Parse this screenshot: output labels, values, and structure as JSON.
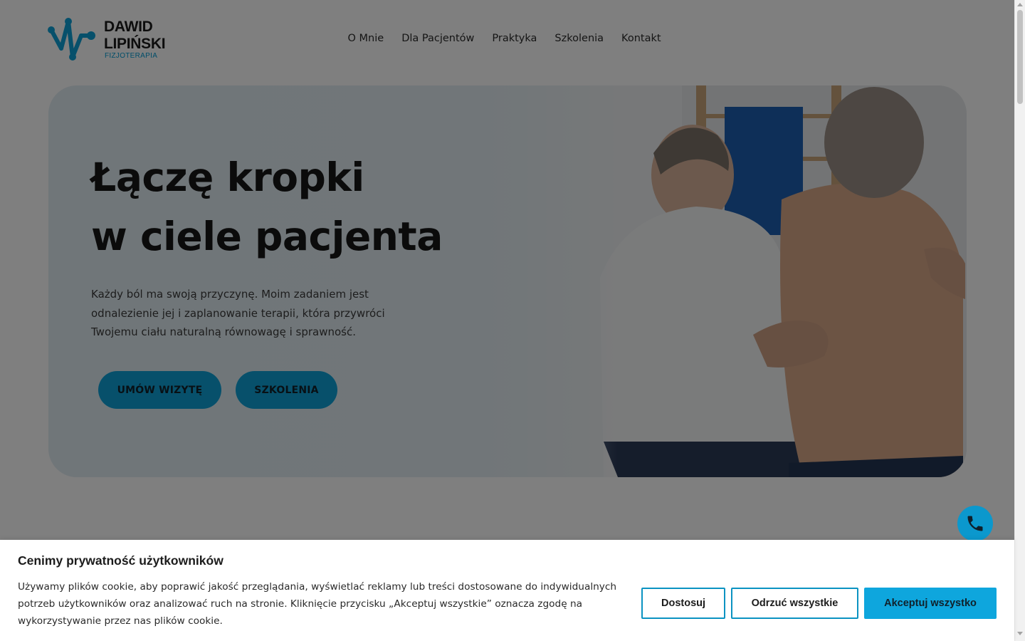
{
  "brand": {
    "name": "DAWID\nLIPIŃSKI",
    "subtitle": "FIZJOTERAPIA",
    "accent_color": "#0ea1d6"
  },
  "nav": {
    "items": [
      {
        "label": "O Mnie"
      },
      {
        "label": "Dla Pacjentów"
      },
      {
        "label": "Praktyka"
      },
      {
        "label": "Szkolenia"
      },
      {
        "label": "Kontakt"
      }
    ]
  },
  "hero": {
    "title_line1": "Łączę kropki",
    "title_line2": "w ciele pacjenta",
    "text": "Każdy ból ma swoją przyczynę. Moim zadaniem jest odnalezienie jej i zaplanowanie terapii, która przywróci Twojemu ciału naturalną równowagę i sprawność.",
    "primary_button": "UMÓW WIZYTĘ",
    "secondary_button": "SZKOLENIA",
    "image_icon": "physiotherapist-treating-patient-photo"
  },
  "floating": {
    "icon": "phone-icon"
  },
  "cookie": {
    "title": "Cenimy prywatność użytkowników",
    "text": "Używamy plików cookie, aby poprawić jakość przeglądania, wyświetlać reklamy lub treści dostosowane do indywidualnych potrzeb użytkowników oraz analizować ruch na stronie. Kliknięcie przycisku „Akceptuj wszystkie” oznacza zgodę na wykorzystywanie przez nas plików cookie.",
    "customize_label": "Dostosuj",
    "reject_label": "Odrzuć wszystkie",
    "accept_label": "Akceptuj wszystko"
  }
}
